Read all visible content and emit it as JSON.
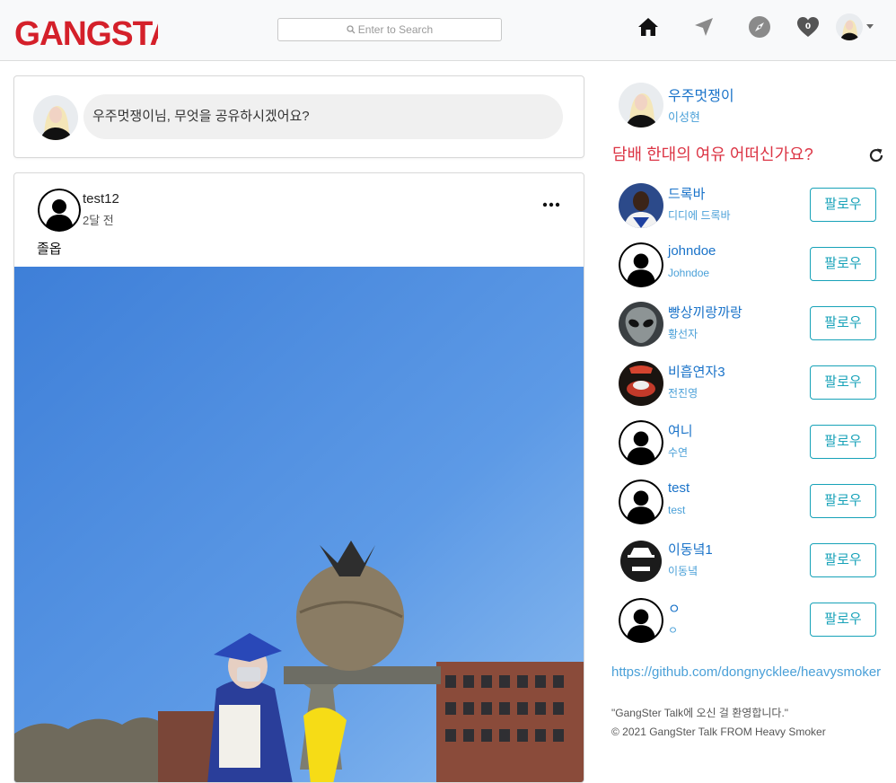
{
  "app": {
    "logo_text": "GANGSTA."
  },
  "search": {
    "placeholder": "Enter to Search"
  },
  "nav": {
    "icons": [
      "home-icon",
      "send-icon",
      "compass-icon",
      "heart-icon"
    ],
    "notification_count": "0"
  },
  "share": {
    "prompt": "우주멋쟁이님, 무엇을 공유하시겠어요?"
  },
  "post": {
    "author": "test12",
    "time": "2달 전",
    "text": "졸옵"
  },
  "sidebar": {
    "me": {
      "name": "우주멋쟁이",
      "sub": "이성현"
    },
    "heading": "담배 한대의 여유 어떠신가요?",
    "follow_label": "팔로우",
    "suggestions": [
      {
        "name": "드록바",
        "sub": "디디에 드록바",
        "avatar": "player"
      },
      {
        "name": "johndoe",
        "sub": "Johndoe",
        "avatar": "default"
      },
      {
        "name": "빵상끼랑까랑",
        "sub": "황선자",
        "avatar": "alien"
      },
      {
        "name": "비흡연자3",
        "sub": "전진영",
        "avatar": "pan"
      },
      {
        "name": "여니",
        "sub": "수연",
        "avatar": "default"
      },
      {
        "name": "test",
        "sub": "test",
        "avatar": "default"
      },
      {
        "name": "이동녘1",
        "sub": "이동녘",
        "avatar": "gangster"
      },
      {
        "name": "ㅇ",
        "sub": "ㅇ",
        "avatar": "default"
      }
    ]
  },
  "footer": {
    "link": "https://github.com/dongnycklee/heavysmoker",
    "welcome": "\"GangSter Talk에 오신 걸 환영합니다.\"",
    "copyright": "© 2021 GangSter Talk FROM Heavy Smoker"
  },
  "colors": {
    "accent": "#17a2b8",
    "link": "#1a73c9",
    "danger": "#dc3545",
    "logo": "#d4202a"
  }
}
